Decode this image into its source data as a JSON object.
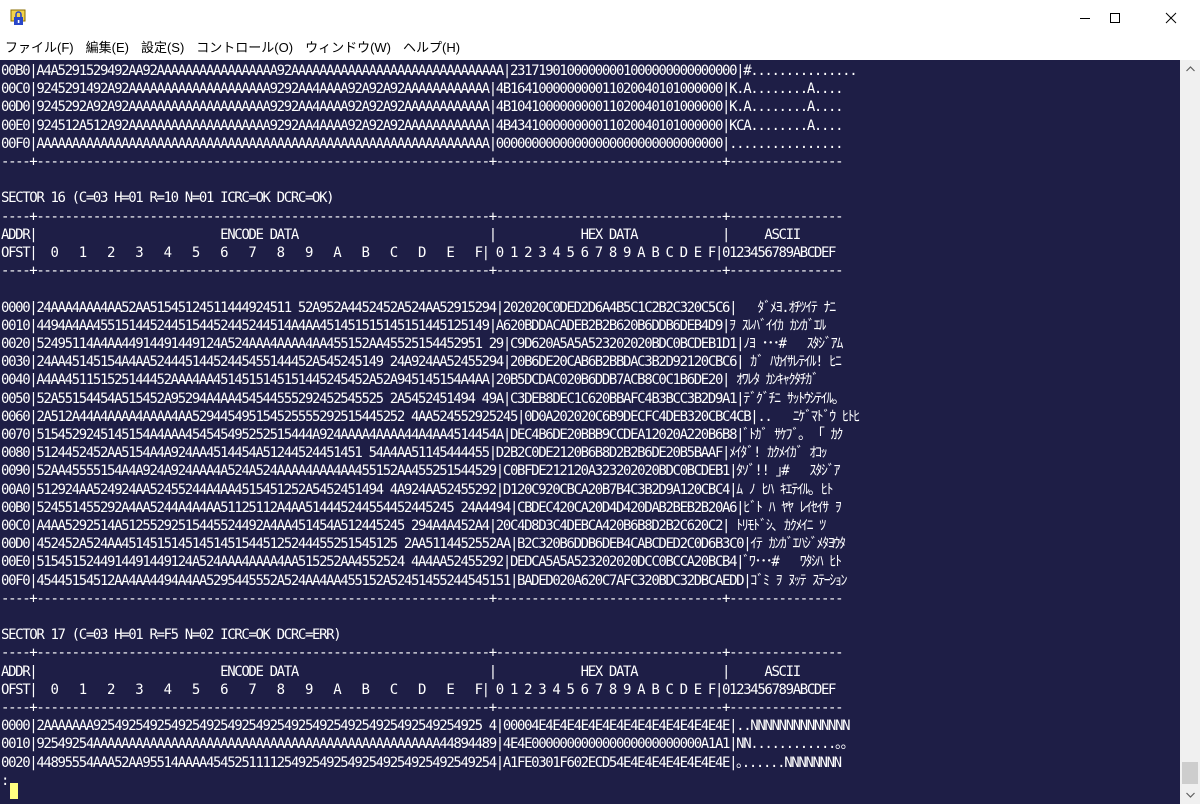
{
  "window": {
    "title": "",
    "icon": "app-lock-icon",
    "controls": [
      "minimize-icon",
      "maximize-icon",
      "close-icon"
    ]
  },
  "menu": [
    "ファイル(F)",
    "編集(E)",
    "設定(S)",
    "コントロール(O)",
    "ウィンドウ(W)",
    "ヘルプ(H)"
  ],
  "console": {
    "lines": [
      "00B0|A4A5291529492AA92AAAAAAAAAAAAAAAAA92AAAAAAAAAAAAAAAAAAAAAAAAAAAAAA|23171901000000001000000000000000|#...............",
      "00C0|9245291492A92AAAAAAAAAAAAAAAAAAAA9292AA4AAAA92A92A92AAAAAAAAAAAA|4B164100000000011020040101000000|K.A........A....",
      "00D0|9245292A92A92AAAAAAAAAAAAAAAAAAAA9292AA4AAAA92A92A92AAAAAAAAAAAA|4B104100000000011020040101000000|K.A........A....",
      "00E0|924512A512A92AAAAAAAAAAAAAAAAAAAA9292AA4AAAA92A92A92AAAAAAAAAAAA|4B434100000000011020040101000000|KCA........A....",
      "00F0|AAAAAAAAAAAAAAAAAAAAAAAAAAAAAAAAAAAAAAAAAAAAAAAAAAAAAAAAAAAAAAAA|00000000000000000000000000000000|................",
      "----+----------------------------------------------------------------+--------------------------------+----------------",
      "",
      "SECTOR 16 (C=03 H=01 R=10 N=01 ICRC=OK DCRC=OK)",
      "----+----------------------------------------------------------------+--------------------------------+----------------",
      "ADDR|                          ENCODE DATA                           |            HEX DATA            |     ASCII",
      "OFST|  0   1   2   3   4   5   6   7   8   9   A   B   C   D   E   F| 0 1 2 3 4 5 6 7 8 9 A B C D E F|0123456789ABCDEF",
      "----+----------------------------------------------------------------+--------------------------------+----------------",
      "",
      "0000|24AAA4AAA4AA52AA51545124511444924511 52A952A4452452A524AA52915294|202020C0DED2D6A4B5C1C2B2C320C5C6|   ﾀﾞﾒﾖ.ｵﾁﾂｲﾃ ﾅﾆ",
      "0010|4494A4AA4551514452445154452445244514A4AA451451515145151445125149|A620BDDACADEB2B2B620B6DDB6DEB4D9|ｦ ｽﾚﾊﾞｲｲｶ ｶﾝｶﾞｴﾙ",
      "0020|52495114A4AA44914491449124A524AAA4AAAA4AA455152AA45525154452951 29|C9D620A5A5A523202020BDC0BCDEB1D1|ﾉﾖ ･･･#   ｽﾀｼﾞｱﾑ",
      "0030|24AA45145154A4AA52444514452445455144452A545245149 24A924AA52455294|20B6DE20CAB6B2BBDAC3B2D92120CBC6| ｶﾞ ﾊｶｲｻﾚﾃｲﾙ! ﾋﾆ",
      "0040|A4AA451151525144452AAA4AA4514515145151445245452A52A945145154A4AA|20B5DCDAC020B6DDB7ACB8C0C1B6DE20| ｵﾜﾚﾀ ｶﾝｷｬｸﾀﾁｶﾞ ",
      "0050|52A55154454A515452A95294A4AA454544555292452545525 2A5452451494 49A|C3DEB8DEC1C620BBAFC4B3BCC3B2D9A1|ﾃﾞｸﾞﾁﾆ ｻｯﾄｳｼﾃｲﾙ｡",
      "0060|2A512A44A4AAAA4AAAA4AA529445495154525555292515445252 4AA524552925245|0D0A202020C6B9DECFC4DEB320CBC4CB|..   ﾆｹﾞﾏﾄﾞｳ ﾋﾄﾋ",
      "0070|5154529245145154A4AAA454545495252515444A924AAAA4AAAA44A4AA4514454A|DEC4B6DE20BBB9CCDEA12020A220B6B8|ﾞﾄｶﾞ ｻｹﾌﾞ｡  ｢ ｶｸ",
      "0080|5124452452AA5154A4A924AA4514454A51244524451451 54A4AA51145444455|D2B2C0DE2120B6B8D2B2B6DE20B5BAAF|ﾒｲﾀﾞ! ｶｸﾒｲｶﾞ ｵｺｯ",
      "0090|52AA45555154A4A924A924AAA4A524A524AAAA4AAA4AA455152AA455251544529|C0BFDE212120A323202020BDC0BCDEB1|ﾀｿﾞ!! ｣#   ｽﾀｼﾞｱ",
      "00A0|512924AA524924AA52455244A4AA4515451252A5452451494 4A924AA52455292|D120C920CBCA20B7B4C3B2D9A120CBC4|ﾑ ﾉ ﾋﾊ ｷｴﾃｲﾙ｡ ﾋﾄ",
      "00B0|524551455292A4AA5244A4A4AA51125112A4AA514445244554452445245 24A4494|CBDEC420CA20D4D420DAB2BEB2B20A6|ﾋﾞﾄ ﾊ ﾔﾔ ﾚｲｾｲｻ ｦ",
      "00C0|A4AA5292514A51255292515445524492A4AA451454A512445245 294A4A452A4|20C4D8D3C4DEBCA420B6B8D2B2C620C2| ﾄﾘﾓﾄﾞｼ､ ｶｸﾒｲﾆ ﾂ",
      "00D0|452452A524AA451451514514514515445125244455251545125 2AA5114452552AA|B2C320B6DDB6DEB4CABCDED2C0D6B3C0|ｲﾃ ｶﾝｶﾞｴﾊｼﾞﾒﾀﾖｳﾀ",
      "00E0|5154515244914491449124A524AAA4AAAA4AA515252AA4552524 4A4AA52455292|DEDCA5A5A523202020DCC0BCCA20BCB4|ﾞﾜ･･･#   ﾜﾀｼﾊ ﾋﾄ",
      "00F0|45445154512AA4AA4494A4AA5295445552A524AA4AA455152A52451455244545151|BADED020A620C7AFC320BDC32DBCAEDD|ｺﾞﾐ ｦ ﾇｯﾃ ｽﾃｰｼｮﾝ",
      "----+----------------------------------------------------------------+--------------------------------+----------------",
      "",
      "SECTOR 17 (C=03 H=01 R=F5 N=02 ICRC=OK DCRC=ERR)",
      "----+----------------------------------------------------------------+--------------------------------+----------------",
      "ADDR|                          ENCODE DATA                           |            HEX DATA            |     ASCII",
      "OFST|  0   1   2   3   4   5   6   7   8   9   A   B   C   D   E   F| 0 1 2 3 4 5 6 7 8 9 A B C D E F|0123456789ABCDEF",
      "----+----------------------------------------------------------------+--------------------------------+----------------",
      "0000|2AAAAAAA9254925492549254925492549254925492549254925492549254925 4|00004E4E4E4E4E4E4E4E4E4E4E4E4E4E|..NNNNNNNNNNNNNN",
      "0010|92549254AAAAAAAAAAAAAAAAAAAAAAAAAAAAAAAAAAAAAAAAAAAAAAAAA44894489|4E4E000000000000000000000000A1A1|NN............｡｡",
      "0020|44895554AAA52AA95514AAAA45452511112549254925492549254925492549254|A1FE0301F602ECD54E4E4E4E4E4E4E4E|｡......NNNNNNNN",
      ":"
    ]
  }
}
